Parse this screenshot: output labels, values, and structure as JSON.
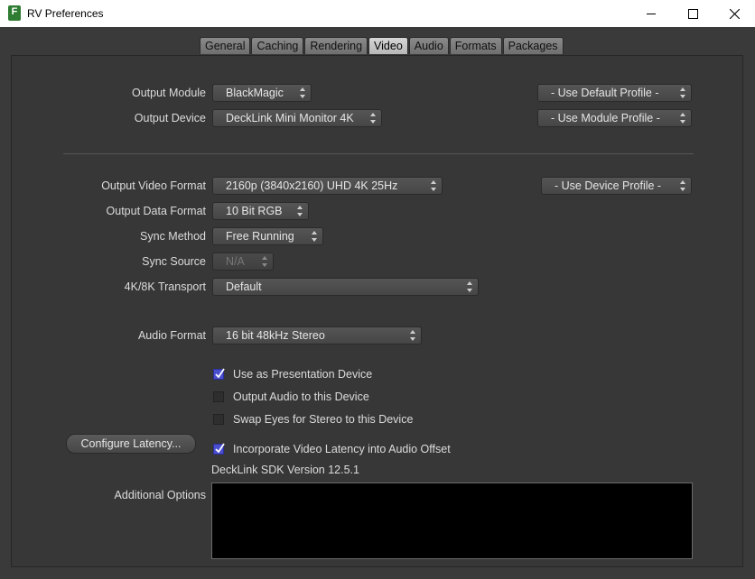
{
  "window": {
    "title": "RV Preferences",
    "icon_letter": "F"
  },
  "tabs": [
    {
      "label": "General",
      "active": false
    },
    {
      "label": "Caching",
      "active": false
    },
    {
      "label": "Rendering",
      "active": false
    },
    {
      "label": "Video",
      "active": true
    },
    {
      "label": "Audio",
      "active": false
    },
    {
      "label": "Formats",
      "active": false
    },
    {
      "label": "Packages",
      "active": false
    }
  ],
  "video": {
    "output_module": {
      "label": "Output Module",
      "value": "BlackMagic",
      "profile": "- Use Default Profile -"
    },
    "output_device": {
      "label": "Output Device",
      "value": "DeckLink Mini Monitor 4K",
      "profile": "- Use Module Profile -"
    },
    "output_video_format": {
      "label": "Output Video Format",
      "value": "2160p (3840x2160) UHD 4K 25Hz",
      "profile": "- Use Device Profile -"
    },
    "output_data_format": {
      "label": "Output Data Format",
      "value": "10 Bit RGB"
    },
    "sync_method": {
      "label": "Sync Method",
      "value": "Free Running"
    },
    "sync_source": {
      "label": "Sync Source",
      "value": "N/A"
    },
    "transport": {
      "label": "4K/8K Transport",
      "value": "Default"
    },
    "audio_format": {
      "label": "Audio Format",
      "value": "16 bit 48kHz Stereo"
    },
    "checks": {
      "presentation": {
        "label": "Use as Presentation Device",
        "checked": true
      },
      "output_audio": {
        "label": "Output Audio to this Device",
        "checked": false
      },
      "swap_eyes": {
        "label": "Swap Eyes for Stereo to this Device",
        "checked": false
      },
      "latency": {
        "label": "Incorporate Video Latency into Audio Offset",
        "checked": true
      }
    },
    "configure_latency_label": "Configure Latency...",
    "sdk_version": "DeckLink SDK Version 12.5.1",
    "additional_options_label": "Additional Options",
    "additional_options_value": ""
  }
}
